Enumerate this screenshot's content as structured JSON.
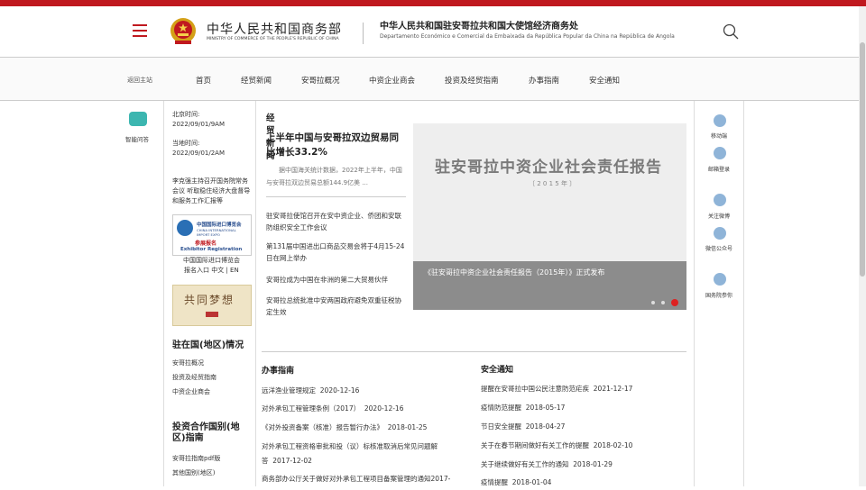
{
  "header": {
    "logo_cn": "中华人民共和国商务部",
    "logo_en": "MINISTRY OF COMMERCE OF THE PEOPLE'S REPUBLIC OF CHINA",
    "embassy_cn": "中华人民共和国驻安哥拉共和国大使馆经济商务处",
    "embassy_pt": "Departamento Económico e Comercial da Embaixada da República Popular da China na República de Angola"
  },
  "nav": {
    "home": "返回主站",
    "items": [
      "首页",
      "经贸新闻",
      "安哥拉概况",
      "中资企业商会",
      "投资及经贸指南",
      "办事指南",
      "安全通知"
    ]
  },
  "left": {
    "robot_label": "智能问答"
  },
  "info": {
    "beijing_label": "北京时间:",
    "beijing_time": "2022/09/01/9AM",
    "local_label": "当地时间:",
    "local_time": "2022/09/01/2AM",
    "news_text": "李克强主持召开国务院常务会议 听取稳住经济大盘督导和服务工作汇报等",
    "expo_t1": "中国国际进口博览会",
    "expo_t2": "CHINA INTERNATIONAL IMPORT EXPO",
    "expo_t3": "参展报名",
    "expo_t4": "Exhibitor Registration",
    "expo_caption": "中国国际进口博览会",
    "expo_links": "报名入口 中文 | EN",
    "dream": "共同梦想",
    "section1": "驻在国(地区)情况",
    "links1": [
      "安哥拉概况",
      "投资及经贸指南",
      "中资企业商会"
    ],
    "section2": "投资合作国别(地区)指南",
    "links2": [
      "安哥拉指南pdf版",
      "其他国别(地区)"
    ]
  },
  "news": {
    "heading": "经贸新闻",
    "headline": "上半年中国与安哥拉双边贸易同比增长33.2%",
    "summary": "据中国海关统计数据，2022年上半年，中国与安哥拉双边贸易总额144.9亿美 ...",
    "links": [
      "驻安哥拉使馆召开在安中资企业、侨团和安联防组织安全工作会议",
      "第131届中国进出口商品交易会将于4月15-24日在网上举办",
      "安哥拉成为中国在非洲的第二大贸易伙伴",
      "安哥拉总统批准中安两国政府避免双重征税协定生效"
    ]
  },
  "carousel": {
    "title": "驻安哥拉中资企业社会责任报告",
    "year": "〔 2 0 1 5 年 〕",
    "caption": "《驻安哥拉中资企业社会责任报告（2015年）》正式发布"
  },
  "guide": {
    "heading": "办事指南",
    "rows": [
      {
        "title": "远洋渔业管理规定",
        "date": "2020-12-16"
      },
      {
        "title": "对外承包工程管理条例（2017）",
        "date": "2020-12-16"
      },
      {
        "title": "《对外投资备案（核准）报告暂行办法》",
        "date": "2018-01-25"
      },
      {
        "title": "对外承包工程资格审批和投（议）标核准取消后常见问题解答",
        "date": "2017-12-02"
      },
      {
        "title": "商务部办公厅关于做好对外承包工程项目备案管理的通知",
        "date": "2017-"
      }
    ]
  },
  "safety": {
    "heading": "安全通知",
    "rows": [
      {
        "title": "提醒在安哥拉中国公民注意防范疟疾",
        "date": "2021-12-17"
      },
      {
        "title": "疫情防范提醒",
        "date": "2018-05-17"
      },
      {
        "title": "节日安全提醒",
        "date": "2018-04-27"
      },
      {
        "title": "关于在春节期间做好有关工作的提醒",
        "date": "2018-02-10"
      },
      {
        "title": "关于继续做好有关工作的通知",
        "date": "2018-01-29"
      },
      {
        "title": "疫情提醒",
        "date": "2018-01-04"
      }
    ]
  },
  "right": {
    "items": [
      "移动端",
      "邮箱登录",
      "关注微博",
      "微信公众号",
      "国务院参你"
    ]
  }
}
